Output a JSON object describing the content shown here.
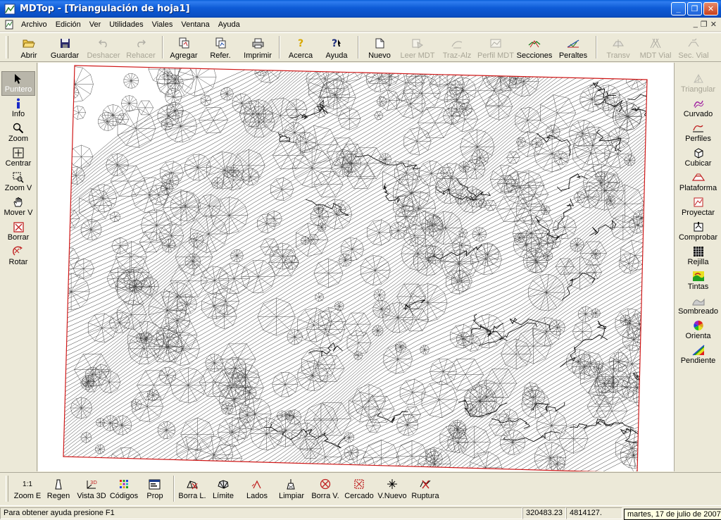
{
  "window": {
    "title": "MDTop - [Triangulación de hoja1]",
    "minimize": "_",
    "maximize": "❐",
    "close": "✕"
  },
  "menu": {
    "items": [
      "Archivo",
      "Edición",
      "Ver",
      "Utilidades",
      "Viales",
      "Ventana",
      "Ayuda"
    ],
    "mdi_minimize": "_",
    "mdi_restore": "❐",
    "mdi_close": "✕"
  },
  "toolbar": {
    "buttons": [
      {
        "label": "Abrir",
        "icon": "open-folder-icon",
        "enabled": true
      },
      {
        "label": "Guardar",
        "icon": "floppy-disk-icon",
        "enabled": true
      },
      {
        "label": "Deshacer",
        "icon": "undo-icon",
        "enabled": false
      },
      {
        "label": "Rehacer",
        "icon": "redo-icon",
        "enabled": false
      },
      {
        "label": "Agregar",
        "icon": "add-document-icon",
        "enabled": true
      },
      {
        "label": "Refer.",
        "icon": "reference-icon",
        "enabled": true
      },
      {
        "label": "Imprimir",
        "icon": "printer-icon",
        "enabled": true
      },
      {
        "label": "Acerca",
        "icon": "about-icon",
        "enabled": true
      },
      {
        "label": "Ayuda",
        "icon": "help-icon",
        "enabled": true
      },
      {
        "label": "Nuevo",
        "icon": "new-document-icon",
        "enabled": true
      },
      {
        "label": "Leer MDT",
        "icon": "read-mdt-icon",
        "enabled": false
      },
      {
        "label": "Traz-Alz",
        "icon": "alignment-icon",
        "enabled": false
      },
      {
        "label": "Perfil MDT",
        "icon": "profile-mdt-icon",
        "enabled": false
      },
      {
        "label": "Secciones",
        "icon": "sections-icon",
        "enabled": true
      },
      {
        "label": "Peraltes",
        "icon": "superelevation-icon",
        "enabled": true
      },
      {
        "label": "Transv",
        "icon": "transversal-icon",
        "enabled": false
      },
      {
        "label": "MDT Vial",
        "icon": "mdt-road-icon",
        "enabled": false
      },
      {
        "label": "Sec. Vial",
        "icon": "road-section-icon",
        "enabled": false
      }
    ]
  },
  "left_tools": [
    {
      "label": "Puntero",
      "icon": "pointer-arrow-icon",
      "active": true
    },
    {
      "label": "Info",
      "icon": "info-icon",
      "active": false
    },
    {
      "label": "Zoom",
      "icon": "magnifier-icon",
      "active": false
    },
    {
      "label": "Centrar",
      "icon": "center-target-icon",
      "active": false
    },
    {
      "label": "Zoom V",
      "icon": "zoom-window-icon",
      "active": false
    },
    {
      "label": "Mover V",
      "icon": "hand-pan-icon",
      "active": false
    },
    {
      "label": "Borrar",
      "icon": "delete-box-icon",
      "active": false
    },
    {
      "label": "Rotar",
      "icon": "rotate-icon",
      "active": false
    }
  ],
  "right_tools": [
    {
      "label": "Triangular",
      "icon": "triangulate-icon",
      "enabled": false
    },
    {
      "label": "Curvado",
      "icon": "contours-icon",
      "enabled": true
    },
    {
      "label": "Perfiles",
      "icon": "profiles-icon",
      "enabled": true
    },
    {
      "label": "Cubicar",
      "icon": "cube-volume-icon",
      "enabled": true
    },
    {
      "label": "Plataforma",
      "icon": "platform-icon",
      "enabled": true
    },
    {
      "label": "Proyectar",
      "icon": "project-icon",
      "enabled": true
    },
    {
      "label": "Comprobar",
      "icon": "check-icon",
      "enabled": true
    },
    {
      "label": "Rejilla",
      "icon": "grid-icon",
      "enabled": true
    },
    {
      "label": "Tintas",
      "icon": "hypsometric-tints-icon",
      "enabled": true
    },
    {
      "label": "Sombreado",
      "icon": "shading-icon",
      "enabled": true
    },
    {
      "label": "Orienta",
      "icon": "aspect-color-wheel-icon",
      "enabled": true
    },
    {
      "label": "Pendiente",
      "icon": "slope-triangle-icon",
      "enabled": true
    }
  ],
  "bottom_tools": [
    {
      "label": "Zoom E",
      "icon_text": "1:1",
      "icon": "zoom-extents-icon"
    },
    {
      "label": "Regen",
      "icon": "regen-icon"
    },
    {
      "label": "Vista 3D",
      "icon": "view-3d-icon"
    },
    {
      "label": "Códigos",
      "icon": "codes-icon"
    },
    {
      "label": "Prop",
      "icon": "properties-icon"
    },
    {
      "label": "Borra L.",
      "icon": "delete-lines-icon"
    },
    {
      "label": "Límite",
      "icon": "boundary-icon"
    },
    {
      "label": "Lados",
      "icon": "sides-icon"
    },
    {
      "label": "Limpiar",
      "icon": "clean-icon"
    },
    {
      "label": "Borra V.",
      "icon": "delete-vertex-icon"
    },
    {
      "label": "Cercado",
      "icon": "fence-icon"
    },
    {
      "label": "V.Nuevo",
      "icon": "new-vertex-icon"
    },
    {
      "label": "Ruptura",
      "icon": "breakline-icon"
    }
  ],
  "status": {
    "help_text": "Para obtener ayuda presione F1",
    "x_coord": "320483.23",
    "y_coord": "4814127.",
    "date_tooltip": "martes, 17 de julio de 2007"
  },
  "colors": {
    "title_bar": "#0a5fd8",
    "boundary": "#d01818",
    "mesh": "#3a3a3a"
  }
}
